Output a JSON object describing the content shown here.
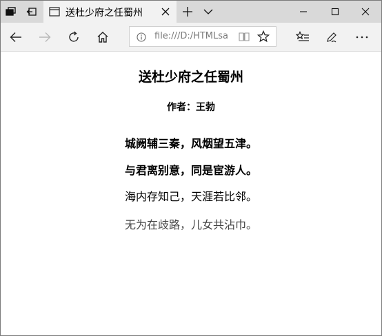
{
  "browser": {
    "tab_title": "送杜少府之任蜀州",
    "address": "file:///D:/HTMLsamp"
  },
  "poem": {
    "title": "送杜少府之任蜀州",
    "author": "作者：王勃",
    "lines": [
      "城阙辅三秦，风烟望五津。",
      "与君离别意，同是宦游人。",
      "海内存知己，天涯若比邻。",
      "无为在歧路，儿女共沾巾。"
    ]
  },
  "icons": {
    "titlebar": [
      "tab-actions-icon",
      "set-aside-tabs-icon",
      "page-icon",
      "close-icon",
      "new-tab-icon",
      "tab-preview-chevron-icon",
      "minimize-icon",
      "maximize-icon",
      "close-window-icon"
    ],
    "toolbar": [
      "back-icon",
      "forward-icon",
      "refresh-icon",
      "home-icon",
      "info-icon",
      "reading-view-icon",
      "favorite-star-icon",
      "favorites-hub-icon",
      "pen-notes-icon",
      "more-icon"
    ]
  }
}
